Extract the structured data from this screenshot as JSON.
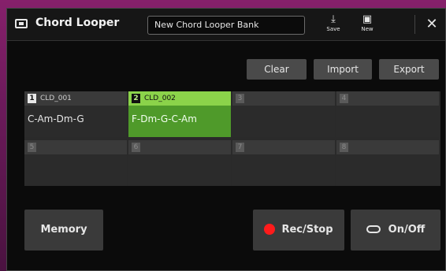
{
  "window": {
    "title": "Chord Looper",
    "bank_name": "New Chord Looper Bank",
    "toolbar": {
      "save_label": "Save",
      "new_label": "New",
      "close_label": "✕",
      "save_icon": "save-icon",
      "new_icon": "new-bank-icon"
    }
  },
  "actions": {
    "clear": "Clear",
    "import": "Import",
    "export": "Export"
  },
  "banks": [
    {
      "num": "1",
      "name": "CLD_001",
      "chords": "C-Am-Dm-G"
    },
    {
      "num": "2",
      "name": "CLD_002",
      "chords": "F-Dm-G-C-Am",
      "active": true
    },
    {
      "num": "3",
      "name": "",
      "chords": ""
    },
    {
      "num": "4",
      "name": "",
      "chords": ""
    },
    {
      "num": "5",
      "name": "",
      "chords": ""
    },
    {
      "num": "6",
      "name": "",
      "chords": ""
    },
    {
      "num": "7",
      "name": "",
      "chords": ""
    },
    {
      "num": "8",
      "name": "",
      "chords": ""
    }
  ],
  "bottom": {
    "memory": "Memory",
    "rec_stop": "Rec/Stop",
    "on_off": "On/Off"
  },
  "colors": {
    "active_header": "#8bd34a",
    "active_body": "#4f9a2a",
    "rec_dot": "#ff1b1b"
  }
}
